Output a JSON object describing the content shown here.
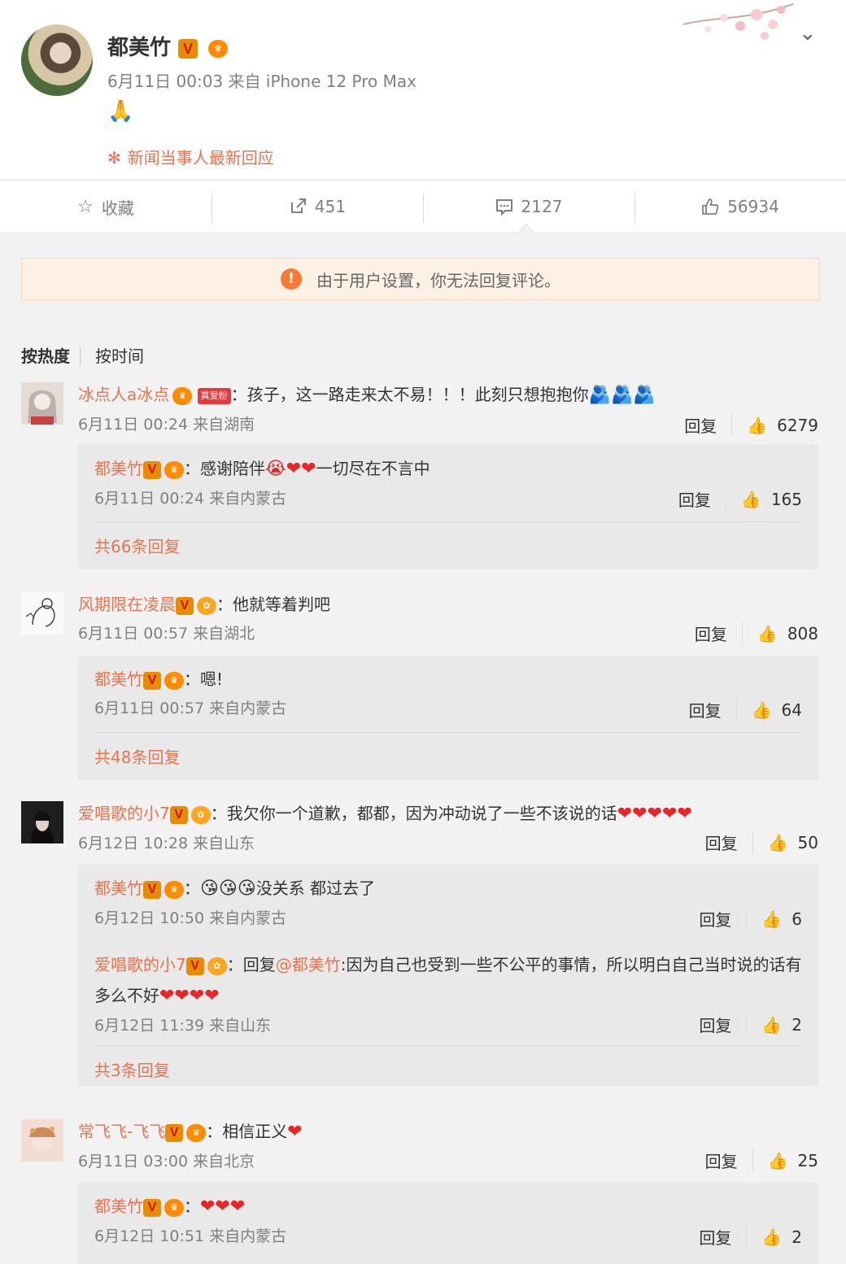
{
  "post": {
    "author": "都美竹",
    "meta": "6月11日 00:03 来自 iPhone 12 Pro Max",
    "content_emoji": "🙏",
    "tag": "新闻当事人最新回应"
  },
  "actions": {
    "favorite": "收藏",
    "repost": "451",
    "comment": "2127",
    "like": "56934"
  },
  "notice": "由于用户设置，你无法回复评论。",
  "sort": {
    "hot": "按热度",
    "time": "按时间"
  },
  "badges": {
    "true_fan": "真爱粉"
  },
  "reply_label": "回复",
  "comments": [
    {
      "user": "冰点人a冰点",
      "text": "：孩子，这一路走来太不易！！！此刻只想抱抱你",
      "emoji": "🫂🫂🫂",
      "meta": "6月11日 00:24 来自湖南",
      "likes": "6279",
      "reply": {
        "user": "都美竹",
        "text": "：感谢陪伴",
        "emoji": "😭❤❤",
        "text2": "一切尽在不言中",
        "meta": "6月11日 00:24 来自内蒙古",
        "likes": "165"
      },
      "more": "共66条回复"
    },
    {
      "user": "风期限在凌晨",
      "text": "：他就等着判吧",
      "meta": "6月11日 00:57 来自湖北",
      "likes": "808",
      "reply": {
        "user": "都美竹",
        "text": "：嗯!",
        "meta": "6月11日 00:57 来自内蒙古",
        "likes": "64"
      },
      "more": "共48条回复"
    },
    {
      "user": "爱唱歌的小7",
      "text": "：我欠你一个道歉，都都，因为冲动说了一些不该说的话",
      "emoji": "❤❤❤❤❤",
      "meta": "6月12日 10:28 来自山东",
      "likes": "50",
      "reply": {
        "user": "都美竹",
        "text": "：",
        "emoji": "😘😘😘",
        "text2": "没关系 都过去了",
        "meta": "6月12日 10:50 来自内蒙古",
        "likes": "6"
      },
      "reply2": {
        "user": "爱唱歌的小7",
        "prefix": "：回复",
        "mention": "@都美竹",
        "text": ":因为自己也受到一些不公平的事情，所以明白自己当时说的话有多么不好",
        "emoji": "❤❤❤❤",
        "meta": "6月12日 11:39 来自山东",
        "likes": "2"
      },
      "more": "共3条回复"
    },
    {
      "user": "常飞飞-飞飞",
      "text": "：相信正义",
      "emoji": "❤",
      "meta": "6月11日 03:00 来自北京",
      "likes": "25",
      "reply": {
        "user": "都美竹",
        "text": "：",
        "emoji": "❤❤❤",
        "meta": "6月12日 10:51 来自内蒙古",
        "likes": "2"
      }
    }
  ]
}
